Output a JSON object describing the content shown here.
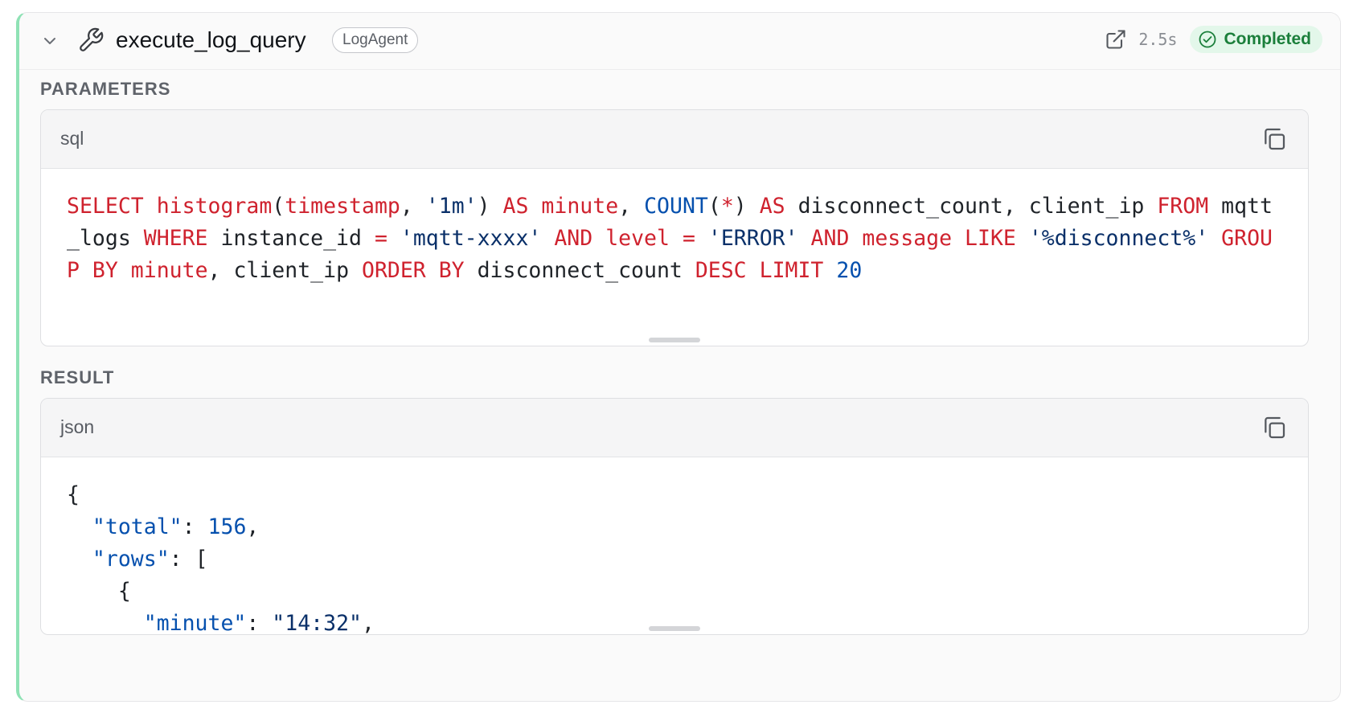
{
  "header": {
    "tool_name": "execute_log_query",
    "agent": "LogAgent",
    "duration": "2.5s",
    "status": "Completed",
    "icons": {
      "collapse": "chevron-down-icon",
      "tool": "wrench-icon",
      "open": "external-link-icon",
      "status": "check-circle-icon"
    }
  },
  "parameters": {
    "label": "PARAMETERS",
    "language": "sql",
    "tokens": {
      "t1": "SELECT",
      "t2": " ",
      "t3": "histogram",
      "t4": "(",
      "t5": "timestamp",
      "t6": ", ",
      "t7": "'1m'",
      "t8": ") ",
      "t9": "AS",
      "t10": " ",
      "t11": "minute",
      "t12": ", ",
      "t13": "COUNT",
      "t14": "(",
      "t15": "*",
      "t16": ") ",
      "t17": "AS",
      "t18": " disconnect_count, client_ip ",
      "t19": "FROM",
      "t20": " mqtt_logs ",
      "t21": "WHERE",
      "t22": " instance_id ",
      "t23": "=",
      "t24": " ",
      "t25": "'mqtt-xxxx'",
      "t26": " ",
      "t27": "AND",
      "t28": " ",
      "t29": "level",
      "t30": " ",
      "t31": "=",
      "t32": " ",
      "t33": "'ERROR'",
      "t34": " ",
      "t35": "AND",
      "t36": " ",
      "t37": "message",
      "t38": " ",
      "t39": "LIKE",
      "t40": " ",
      "t41": "'%disconnect%'",
      "t42": " ",
      "t43": "GROUP BY",
      "t44": " ",
      "t45": "minute",
      "t46": ", client_ip ",
      "t47": "ORDER BY",
      "t48": " disconnect_count ",
      "t49": "DESC",
      "t50": " ",
      "t51": "LIMIT",
      "t52": " ",
      "t53": "20"
    }
  },
  "result": {
    "label": "RESULT",
    "language": "json",
    "tokens": {
      "j1": "{\n  ",
      "j2": "\"total\"",
      "j3": ": ",
      "j4": "156",
      "j5": ",\n  ",
      "j6": "\"rows\"",
      "j7": ": [\n    {\n      ",
      "j8": "\"minute\"",
      "j9": ": ",
      "j10": "\"14:32\"",
      "j11": ","
    }
  },
  "colors": {
    "accent_border": "#8fe2b5",
    "status_bg": "#e3f7ea",
    "status_text": "#1b7f3b",
    "keyword": "#cf222e",
    "string": "#0a3069",
    "number": "#0550ae"
  }
}
